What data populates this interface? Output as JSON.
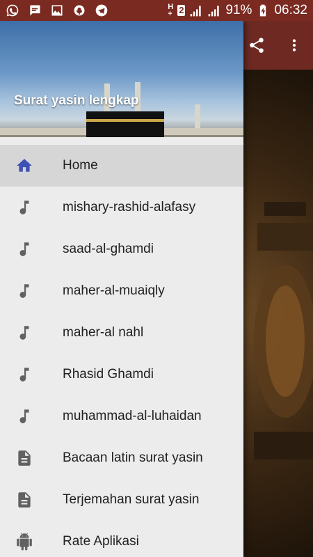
{
  "status_bar": {
    "left_icons": [
      "whatsapp-icon",
      "message-icon",
      "gallery-icon",
      "voice-icon",
      "telegram-icon"
    ],
    "sim_label": "2",
    "network_label_top": "H",
    "network_label_bottom": "+",
    "battery": "91%",
    "time": "06:32"
  },
  "toolbar": {
    "icons": [
      "share-icon",
      "more-vert-icon"
    ]
  },
  "drawer": {
    "title": "Surat yasin lengkap",
    "items": [
      {
        "label": "Home",
        "icon": "home-icon",
        "active": true
      },
      {
        "label": "mishary-rashid-alafasy",
        "icon": "music-note-icon"
      },
      {
        "label": "saad-al-ghamdi",
        "icon": "music-note-icon"
      },
      {
        "label": "maher-al-muaiqly",
        "icon": "music-note-icon"
      },
      {
        "label": "maher-al nahl",
        "icon": "music-note-icon"
      },
      {
        "label": "Rhasid Ghamdi",
        "icon": "music-note-icon"
      },
      {
        "label": "muhammad-al-luhaidan",
        "icon": "music-note-icon"
      },
      {
        "label": "Bacaan latin surat yasin",
        "icon": "document-icon"
      },
      {
        "label": "Terjemahan surat yasin",
        "icon": "document-icon"
      },
      {
        "label": "Rate Aplikasi",
        "icon": "android-icon"
      }
    ]
  },
  "colors": {
    "status_bar": "#7a2a21",
    "toolbar": "#6e2a22",
    "drawer_bg": "#ececec",
    "active_item_bg": "#d6d6d6",
    "accent": "#3f51b5"
  }
}
